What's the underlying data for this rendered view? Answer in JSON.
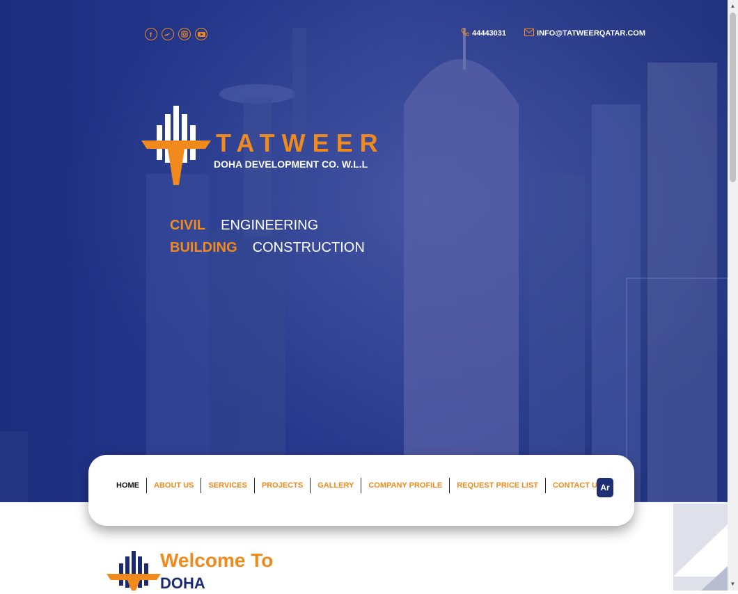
{
  "contact": {
    "phone": "44443031",
    "email": "INFO@TATWEERQATAR.COM"
  },
  "social": [
    "facebook-icon",
    "twitter-icon",
    "instagram-icon",
    "youtube-icon"
  ],
  "brand": {
    "name": "TATWEER",
    "subtitle": "DOHA DEVELOPMENT CO. W.L.L"
  },
  "tagline": {
    "line1": {
      "accent": "CIVIL",
      "text": "ENGINEERING"
    },
    "line2": {
      "accent": "BUILDING",
      "text": "CONSTRUCTION"
    }
  },
  "nav": {
    "items": [
      "HOME",
      "ABOUT US",
      "SERVICES",
      "PROJECTS",
      "GALLERY",
      "COMPANY PROFILE",
      "REQUEST PRICE LIST",
      "CONTACT US"
    ],
    "lang": "Ar"
  },
  "welcome": {
    "title": "Welcome To",
    "subtitle": "DOHA"
  },
  "colors": {
    "accent": "#f08a1c",
    "navy": "#1f2f75"
  }
}
